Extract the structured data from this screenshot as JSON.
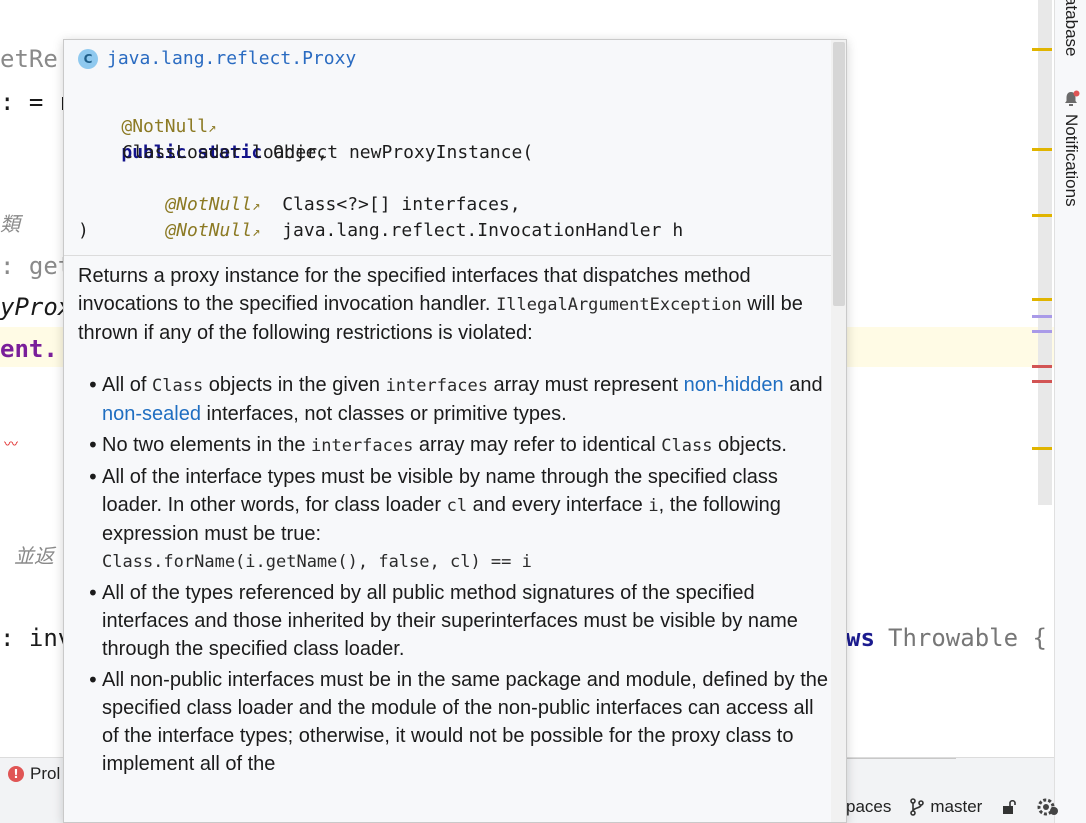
{
  "editor": {
    "fragments": {
      "set_re": "etRe",
      "eq_r": ": = r",
      "ital_char": "類",
      "get": ": get",
      "new_prox": "yProx",
      "ent": "ent.",
      "bing_fan": "並返",
      "inv": ": inv",
      "ws_throwable_ws": "ws",
      "ws_throwable_text": "Throwable {"
    }
  },
  "right_bar": {
    "database_label": "atabase",
    "notifications_label": "Notifications"
  },
  "status_bar": {
    "problems_label": "Prol",
    "workspaces_label": "paces",
    "branch_label": "master"
  },
  "doc_popup": {
    "class_icon_letter": "C",
    "class_name": "java.lang.reflect.Proxy",
    "signature": {
      "annotation": "@NotNull",
      "modifiers": "public static",
      "return_and_name": "Object newProxyInstance(",
      "param1": "ClassLoader loader,",
      "param2_ann": "@NotNull",
      "param2": "Class<?>[] interfaces,",
      "param3_ann": "@NotNull",
      "param3": "java.lang.reflect.InvocationHandler h",
      "close": ")"
    },
    "intro_text": "Returns a proxy instance for the specified interfaces that dispatches method invocations to the specified invocation handler.",
    "exception_name": "IllegalArgumentException",
    "exception_text": "will be thrown if any of the following restrictions is violated:",
    "items": {
      "b1_a": "All of",
      "b1_code1": "Class",
      "b1_b": "objects in the given",
      "b1_code2": "interfaces",
      "b1_c": "array must represent",
      "b1_link1": "non-hidden",
      "b1_d": "and",
      "b1_link2": "non-sealed",
      "b1_e": "interfaces, not classes or primitive types.",
      "b2_a": "No two elements in the",
      "b2_code1": "interfaces",
      "b2_b": "array may refer to identical",
      "b2_code2": "Class",
      "b2_c": "objects.",
      "b3_a": "All of the interface types must be visible by name through the specified class loader. In other words, for class loader",
      "b3_code1": "cl",
      "b3_b": "and every interface",
      "b3_code2": "i",
      "b3_c": ", the following expression must be true:",
      "b3_code3": "Class.forName(i.getName(), false, cl) == i",
      "b4": "All of the types referenced by all public method signatures of the specified interfaces and those inherited by their superinterfaces must be visible by name through the specified class loader.",
      "b5": "All non-public interfaces must be in the same package and module, defined by the specified class loader and the module of the non-public interfaces can access all of the interface types; otherwise, it would not be possible for the proxy class to implement all of the"
    }
  },
  "colors": {
    "marker_yellow": "#e0b400",
    "marker_purple": "#a99ae8",
    "marker_red": "#d25454",
    "link_blue": "#1f6ec1",
    "annotation_olive": "#8c7a24"
  }
}
